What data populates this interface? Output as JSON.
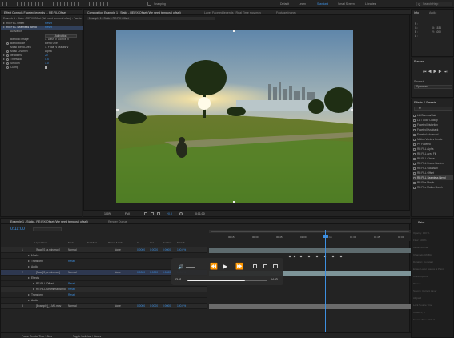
{
  "topbar": {
    "snapping": "Snapping",
    "workspaces": [
      "Default",
      "Learn",
      "Standard",
      "Small Screen",
      "Libraries"
    ],
    "active_workspace": "Standard",
    "search_placeholder": "Search Help"
  },
  "effect_controls": {
    "tab": "Effect Controls Faceted legends ... RE:FIL Offset",
    "breadcrumb": "Example 1 - Static - REFIX Offset (We need temporal offset) - Faceted",
    "effect_name": "RE:FILL Offset",
    "reset": "Reset",
    "rows": [
      {
        "label": "RE:FILL Seamless Blend",
        "value": "Reset",
        "selected": true
      },
      {
        "label": "Activation",
        "value": ""
      },
      {
        "label": "",
        "value": "Activation"
      },
      {
        "label": "Blend to Image",
        "value": "1. Dash ∨  Source ∨"
      },
      {
        "label": "Blend Mode",
        "value": "Blend Over"
      },
      {
        "label": "Mask Blend Area",
        "value": "1. Focal ∨  Masks ∨"
      },
      {
        "label": "Mask Channel",
        "value": "Alpha"
      },
      {
        "label": "Iterations",
        "value": "20"
      },
      {
        "label": "Threshold",
        "value": "0.5"
      },
      {
        "label": "Smooth",
        "value": "1.0"
      },
      {
        "label": "Clamp",
        "value": ""
      }
    ]
  },
  "composition": {
    "tab": "Composition Example 1 - Static - REFIX Offset (We need temporal offset)",
    "layer_tab": "Layer Faceted legends_ Real Time mov.mov",
    "footage_tab": "Footage (none)",
    "breadcrumb": "Example 1 - Static - RE:FIX Offset",
    "zoom": "100%",
    "resolution": "Full",
    "timecode": "0:01:00",
    "extra": "+0.0"
  },
  "info_panel": {
    "tabs": [
      "Info",
      "Audio"
    ],
    "values": [
      "R :",
      "G :",
      "B :",
      "A :",
      "X: 1536",
      "Y: 1000"
    ]
  },
  "preview_panel": {
    "title": "Preview",
    "shortcut_label": "Shortcut",
    "shortcut_value": "Spacebar"
  },
  "effects_presets": {
    "title": "Effects & Presets",
    "search_value": "re",
    "items": [
      "Lift/Gamma/Gain",
      "LUT Color Lookup",
      "Faceted Distortion",
      "Faceted Pushback",
      "Faceted Advanced",
      "Motion Vectors Create",
      "PV Faceted",
      "RE:FILL Alpha",
      "RE:FILL Area Fill",
      "RE:FILL Choke",
      "RE:FILL Frame Borders",
      "RE:FILL Gaussian",
      "RE:FILL Offset",
      "RE:FILL Seamless Blend",
      "RE:Flex Morph",
      "RE:Flex Motion Morph"
    ],
    "selected_index": 13
  },
  "timeline": {
    "tab": "Example 1 - Static - RE:FIX Offset (We need temporal offset)",
    "render_queue": "Render Queue",
    "timecode": "0:11:00",
    "columns": [
      "Layer Name",
      "Mode",
      "T TrkMat",
      "Parent & Link",
      "In",
      "Out",
      "Duration",
      "Stretch"
    ],
    "ruler": [
      "00:15",
      "00:30",
      "00:45",
      "01:00",
      "01:15",
      "01:30",
      "01:45",
      "02:00",
      "02:15"
    ],
    "rows": [
      {
        "num": "1",
        "name": "[Face]S_a.mkv.mov]",
        "mode": "Normal",
        "parent": "None",
        "in": "0:0000",
        "out": "0:0000",
        "dur": "0:0000",
        "stretch": "100.0%",
        "kind": "layer"
      },
      {
        "num": "",
        "name": "Masks",
        "kind": "group"
      },
      {
        "num": "",
        "name": "Transform",
        "value": "Reset",
        "kind": "group"
      },
      {
        "num": "",
        "name": "Audio",
        "kind": "group"
      },
      {
        "num": "2",
        "name": "[Face]S_a.mkv.mov]",
        "mode": "Normal",
        "parent": "None",
        "in": "0:0000",
        "out": "0:0000",
        "dur": "0:0000",
        "stretch": "100.0%",
        "kind": "layer"
      },
      {
        "num": "",
        "name": "Effects",
        "kind": "group"
      },
      {
        "num": "",
        "name": "RE:FILL Offset",
        "value": "Reset",
        "kind": "fx"
      },
      {
        "num": "",
        "name": "RE:FILL Seamless Blend",
        "value": "Reset",
        "kind": "fx"
      },
      {
        "num": "",
        "name": "Transform",
        "value": "Reset",
        "kind": "group"
      },
      {
        "num": "",
        "name": "Audio",
        "kind": "group"
      },
      {
        "num": "3",
        "name": "[Example]_1.MK.mov",
        "mode": "Normal",
        "parent": "None",
        "in": "0:0000",
        "out": "0:0000",
        "dur": "0:0000",
        "stretch": "100.0%",
        "kind": "layer"
      }
    ],
    "footer": [
      "Frame Render Time 1.5ms",
      "Toggle Switches / Modes"
    ]
  },
  "media_player": {
    "current": "03:01",
    "total": "04:03",
    "progress": 0.72
  },
  "right_bottom": {
    "title": "Paint",
    "labels": [
      "Opacity: 100 %",
      "Flow: 100 %",
      "Mode: Normal",
      "Channels: RGBA",
      "Duration: Constant",
      "Erase: Layer Source & Paint",
      "Clone Options",
      "Preset:",
      "Source: Current Layer",
      "Aligned",
      "Lock Source Time",
      "Offset: 0, 0",
      "Source Time Shift: 0 f"
    ]
  }
}
